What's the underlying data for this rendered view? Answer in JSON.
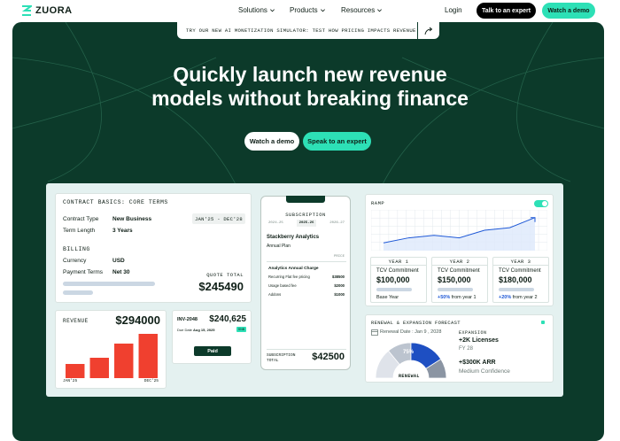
{
  "brand": {
    "name": "ZUORA",
    "accent": "#2de0b6",
    "dark": "#0c3a2a"
  },
  "nav": {
    "items": [
      {
        "label": "Solutions"
      },
      {
        "label": "Products"
      },
      {
        "label": "Resources"
      }
    ],
    "login": "Login",
    "talk_expert": "Talk to an expert",
    "watch_demo": "Watch a demo"
  },
  "banner": {
    "text": "TRY OUR NEW AI MONETIZATION SIMULATOR: TEST HOW PRICING IMPACTS REVENUE"
  },
  "hero": {
    "headline_line1": "Quickly launch new revenue",
    "headline_line2": "models without breaking finance",
    "cta_demo": "Watch a demo",
    "cta_expert": "Speak to an expert"
  },
  "contract": {
    "title": "CONTRACT BASICS: CORE TERMS",
    "date_range": "JAN'25 - DEC'28",
    "rows": [
      {
        "key": "Contract Type",
        "value": "New Business"
      },
      {
        "key": "Term Length",
        "value": "3 Years"
      }
    ],
    "billing_title": "BILLING",
    "billing_rows": [
      {
        "key": "Currency",
        "value": "USD"
      },
      {
        "key": "Payment Terms",
        "value": "Net 30"
      }
    ],
    "quote_label": "QUOTE TOTAL",
    "quote_value": "$245490"
  },
  "revenue": {
    "title": "REVENUE",
    "total": "$294000",
    "start_label": "JAN'25",
    "end_label": "DEC'25",
    "bars": [
      0.32,
      0.46,
      0.78,
      1.0
    ],
    "bar_color": "#f0402f"
  },
  "invoice": {
    "id": "INV-2048",
    "amount": "$240,625",
    "due_label": "Due Date",
    "due_date": "Aug 15, 2025",
    "badge": "SNB",
    "status": "Paid"
  },
  "subscription": {
    "title": "SUBSCRIPTION",
    "tabs": [
      "2024-25",
      "2025-26",
      "2026-27"
    ],
    "active_tab": 1,
    "company": "Stackberry Analytics",
    "plan": "Annual Plan",
    "price_label": "PRICE",
    "charge_title": "Analytics Annual Charge",
    "lines": [
      {
        "label": "Recurring Flat fee pricing",
        "value": "$38500"
      },
      {
        "label": "Usage based fee",
        "value": "$2000"
      },
      {
        "label": "Addons",
        "value": "$1000"
      }
    ],
    "total_label_1": "SUBSCRIPTION",
    "total_label_2": "TOTAL",
    "total_value": "$42500"
  },
  "ramp": {
    "title": "RAMP",
    "years": [
      {
        "header": "YEAR 1",
        "label": "TCV Commitment",
        "value": "$100,000",
        "note": "Base Year",
        "delta": ""
      },
      {
        "header": "YEAR 2",
        "label": "TCV Commitment",
        "value": "$150,000",
        "note": "from year 1",
        "delta": "+50%"
      },
      {
        "header": "YEAR 3",
        "label": "TCV Commitment",
        "value": "$180,000",
        "note": "from year 2",
        "delta": "+20%"
      }
    ]
  },
  "chart_data": {
    "type": "area",
    "x": [
      0,
      1,
      2,
      3,
      4,
      5,
      6
    ],
    "values": [
      2,
      4,
      5,
      4,
      7,
      8,
      12
    ],
    "ylim": [
      0,
      14
    ],
    "grid": true,
    "line_color": "#1e58d6"
  },
  "forecast": {
    "title": "RENEWAL & EXPANSION FORECAST",
    "renewal_label": "Renewal Date : Jan 9 , 2028",
    "gauge_pct": "75%",
    "gauge_label": "RENEWAL",
    "gauge_value": 0.75,
    "expansion_title": "EXPANSION",
    "licenses": "+2K Licenses",
    "fy": "FY 28",
    "arr": "+$300K ARR",
    "confidence": "Medium Confidence"
  }
}
